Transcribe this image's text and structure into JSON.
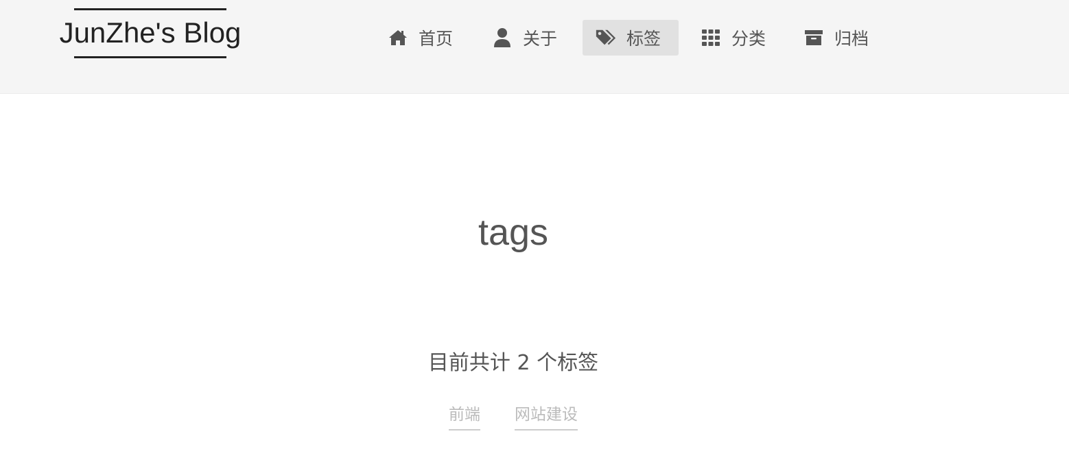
{
  "site": {
    "brand": "JunZhe's Blog"
  },
  "nav": {
    "items": [
      {
        "label": "首页",
        "icon": "home-icon"
      },
      {
        "label": "关于",
        "icon": "user-icon"
      },
      {
        "label": "标签",
        "icon": "tags-icon",
        "active": true
      },
      {
        "label": "分类",
        "icon": "grid-icon"
      },
      {
        "label": "归档",
        "icon": "archive-icon"
      }
    ]
  },
  "main": {
    "title": "tags",
    "summary": "目前共计 2 个标签",
    "tags": [
      "前端",
      "网站建设"
    ]
  },
  "colors": {
    "header_bg": "#f5f5f5",
    "active_bg": "#e1e1e1",
    "text": "#555555",
    "tag_text": "#bbbbbb"
  }
}
